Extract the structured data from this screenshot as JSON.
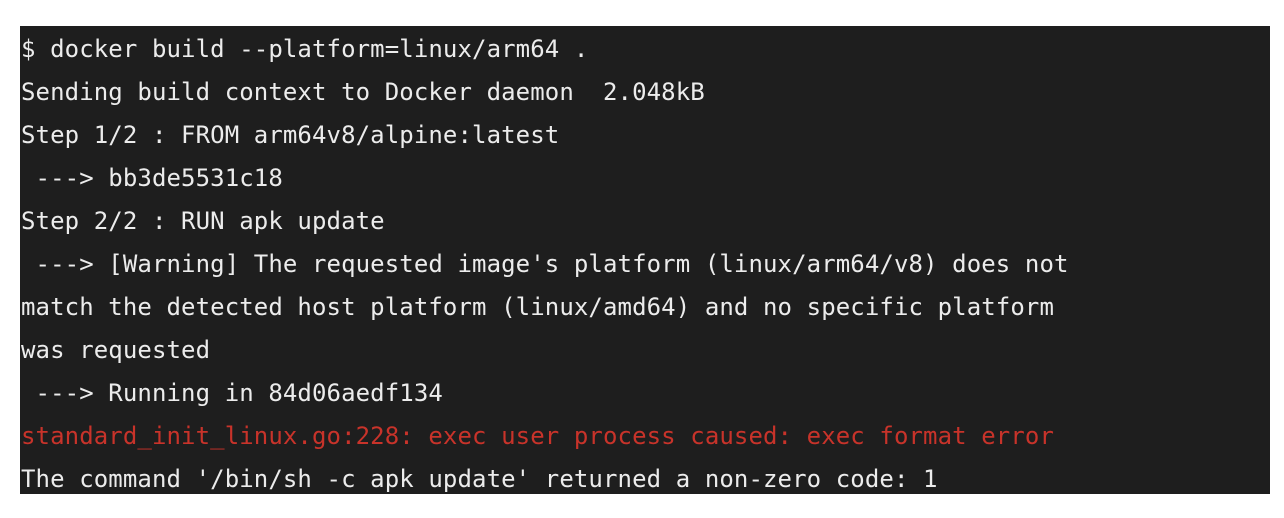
{
  "terminal": {
    "lines": [
      {
        "text": "$ docker build --platform=linux/arm64 .",
        "kind": "command"
      },
      {
        "text": "Sending build context to Docker daemon  2.048kB",
        "kind": "output"
      },
      {
        "text": "Step 1/2 : FROM arm64v8/alpine:latest",
        "kind": "output"
      },
      {
        "text": " ---> bb3de5531c18",
        "kind": "output"
      },
      {
        "text": "Step 2/2 : RUN apk update",
        "kind": "output"
      },
      {
        "text": " ---> [Warning] The requested image's platform (linux/arm64/v8) does not",
        "kind": "output"
      },
      {
        "text": "match the detected host platform (linux/amd64) and no specific platform",
        "kind": "output"
      },
      {
        "text": "was requested",
        "kind": "output"
      },
      {
        "text": " ---> Running in 84d06aedf134",
        "kind": "output"
      },
      {
        "text": "standard_init_linux.go:228: exec user process caused: exec format error",
        "kind": "error"
      },
      {
        "text": "The command '/bin/sh -c apk update' returned a non-zero code: 1",
        "kind": "output"
      }
    ],
    "colors": {
      "background": "#1e1e1e",
      "text": "#ececec",
      "error": "#c8332a"
    }
  }
}
